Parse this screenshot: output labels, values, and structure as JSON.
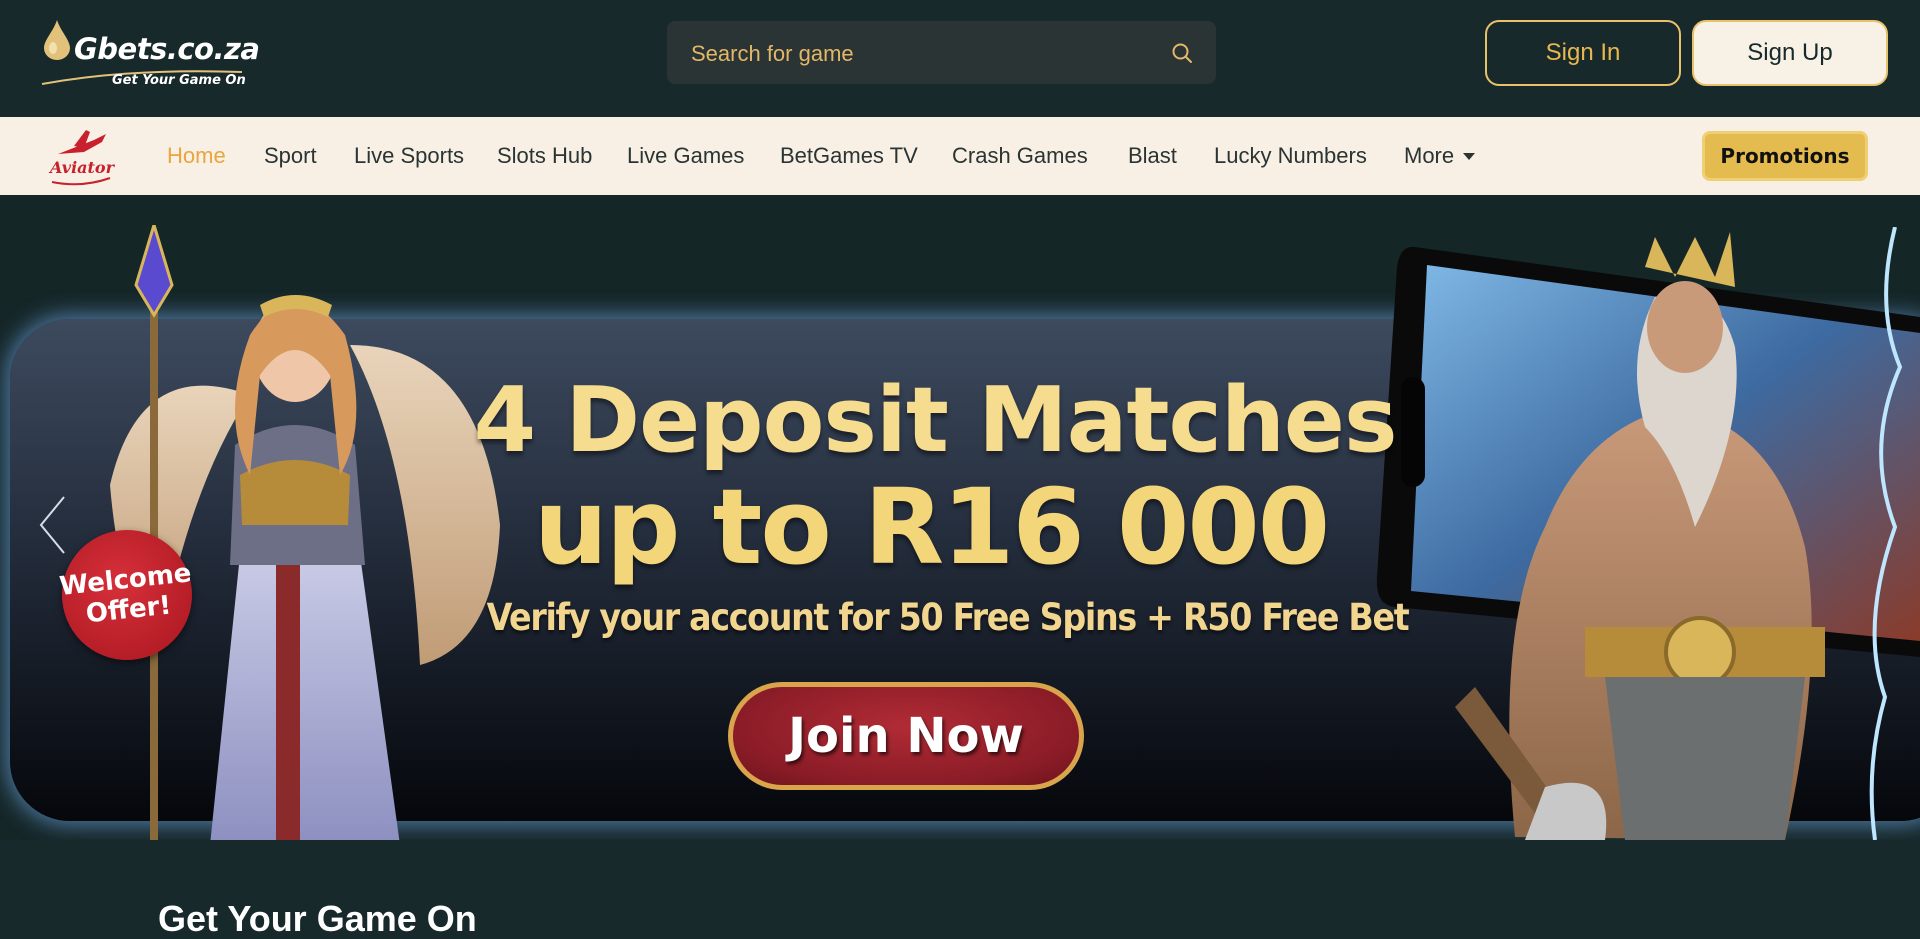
{
  "header": {
    "logo": {
      "name": "Gbets.co.za",
      "tagline": "Get Your Game On"
    },
    "search": {
      "placeholder": "Search for game",
      "icon": "search-icon"
    },
    "signin_label": "Sign In",
    "signup_label": "Sign Up"
  },
  "nav": {
    "brand_logo": "Aviator",
    "items": [
      "Home",
      "Sport",
      "Live Sports",
      "Slots Hub",
      "Live Games",
      "BetGames TV",
      "Crash Games",
      "Blast",
      "Lucky Numbers",
      "More"
    ],
    "active": "Home",
    "promotions_label": "Promotions"
  },
  "banner": {
    "badge_line1": "Welcome",
    "badge_line2": "Offer!",
    "headline_1": "4 Deposit Matches",
    "headline_2": "up to R16 000",
    "subline": "Verify your account for 50 Free Spins + R50 Free Bet",
    "cta_label": "Join Now"
  },
  "section": {
    "title": "Get Your Game On"
  },
  "colors": {
    "bg": "#17292a",
    "nav_bg": "#f8f0e4",
    "accent": "#e8b84e",
    "cta": "#9b1f2a"
  }
}
